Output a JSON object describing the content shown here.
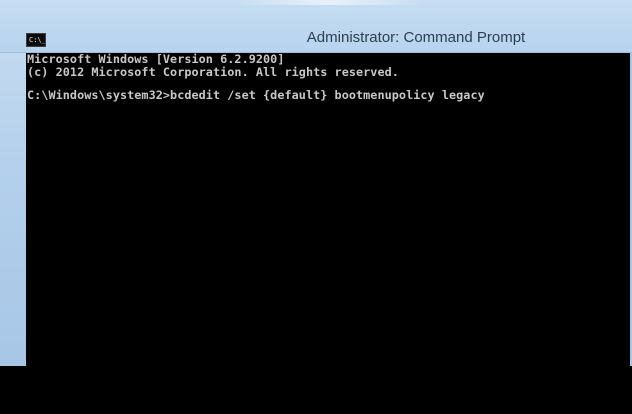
{
  "window": {
    "title": "Administrator: Command Prompt",
    "icon": "command-prompt-icon",
    "icon_text": "C:\\_"
  },
  "console": {
    "lines": [
      "Microsoft Windows [Version 6.2.9200]",
      "(c) 2012 Microsoft Corporation. All rights reserved.",
      "",
      "C:\\Windows\\system32>bcdedit /set {default} bootmenupolicy legacy"
    ]
  },
  "colors": {
    "console_background": "#000000",
    "console_text": "#c8c8c8",
    "frame": "#b4d0ec",
    "title_text": "#2d3e50"
  }
}
